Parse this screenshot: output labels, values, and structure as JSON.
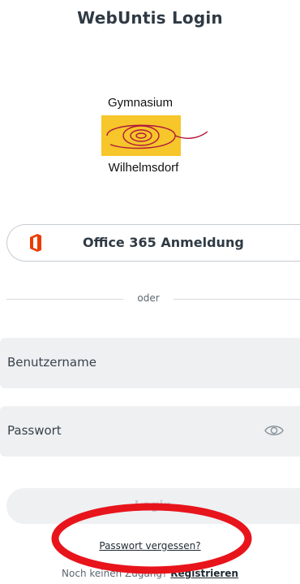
{
  "header": {
    "title": "WebUntis Login"
  },
  "logo": {
    "top_text": "Gymnasium",
    "bottom_text": "Wilhelmsdorf",
    "box_color": "#f6c62a",
    "swirl_color": "#b0183d"
  },
  "office": {
    "label": "Office 365 Anmeldung",
    "icon": "office-icon",
    "icon_color": "#eb3c00"
  },
  "divider": {
    "text": "oder"
  },
  "form": {
    "username_placeholder": "Benutzername",
    "password_placeholder": "Passwort",
    "login_label": "Login"
  },
  "links": {
    "forgot_password": "Passwort vergessen?",
    "no_access": "Noch keinen Zugang?",
    "register": "Registrieren"
  },
  "annotation": {
    "shape": "ellipse",
    "color": "#e8141c"
  }
}
